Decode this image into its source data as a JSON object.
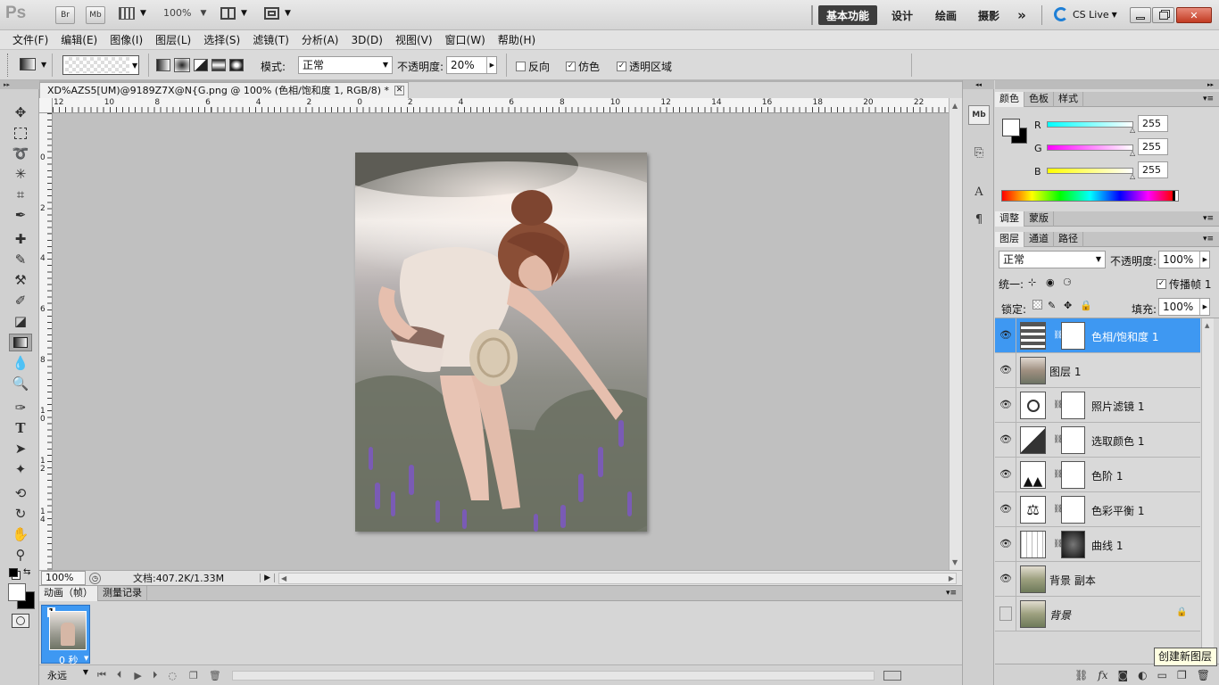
{
  "app": {
    "logo": "Ps",
    "bridge": "Br",
    "minibridge": "Mb",
    "zoom": "100%"
  },
  "workspaces": [
    "基本功能",
    "设计",
    "绘画",
    "摄影"
  ],
  "more_ws": "»",
  "cslive": "CS Live",
  "menu": [
    "文件(F)",
    "编辑(E)",
    "图像(I)",
    "图层(L)",
    "选择(S)",
    "滤镜(T)",
    "分析(A)",
    "3D(D)",
    "视图(V)",
    "窗口(W)",
    "帮助(H)"
  ],
  "options": {
    "mode_label": "模式:",
    "mode_value": "正常",
    "opacity_label": "不透明度:",
    "opacity_value": "20%",
    "reverse": "反向",
    "dither": "仿色",
    "transparency": "透明区域"
  },
  "document": {
    "tab_title": "XD%AZS5[UM)@9189Z7X@N{G.png @ 100% (色相/饱和度 1, RGB/8) *",
    "zoom": "100%",
    "doc_info": "文档:407.2K/1.33M"
  },
  "ruler": {
    "h": [
      "12",
      "10",
      "8",
      "6",
      "4",
      "2",
      "0",
      "2",
      "4",
      "6",
      "8",
      "10",
      "12",
      "14",
      "16",
      "18",
      "20",
      "22"
    ],
    "v": [
      "0",
      "2",
      "4",
      "6",
      "8",
      "10",
      "12",
      "14"
    ]
  },
  "animation": {
    "tabs": [
      "动画（帧）",
      "测量记录"
    ],
    "frame_number": "1",
    "frame_delay": "0 秒",
    "loop": "永远"
  },
  "color_panel": {
    "tabs": [
      "颜色",
      "色板",
      "样式"
    ],
    "channels": [
      {
        "label": "R",
        "value": "255"
      },
      {
        "label": "G",
        "value": "255"
      },
      {
        "label": "B",
        "value": "255"
      }
    ]
  },
  "adjust_panel": {
    "tabs": [
      "调整",
      "蒙版"
    ]
  },
  "layers_panel": {
    "tabs": [
      "图层",
      "通道",
      "路径"
    ],
    "blend_mode": "正常",
    "opacity_label": "不透明度:",
    "opacity_value": "100%",
    "unify_label": "统一:",
    "propagate_label": "传播帧 1",
    "lock_label": "锁定:",
    "fill_label": "填充:",
    "fill_value": "100%",
    "layers": [
      {
        "name": "色相/饱和度 1",
        "selected": true
      },
      {
        "name": "图层 1"
      },
      {
        "name": "照片滤镜 1"
      },
      {
        "name": "选取颜色 1"
      },
      {
        "name": "色阶 1"
      },
      {
        "name": "色彩平衡 1"
      },
      {
        "name": "曲线 1"
      },
      {
        "name": "背景 副本"
      },
      {
        "name": "背景"
      }
    ]
  },
  "tooltip": "创建新图层",
  "colors": {
    "selection": "#3e98f2",
    "active_ws": "#3d3d3d"
  }
}
